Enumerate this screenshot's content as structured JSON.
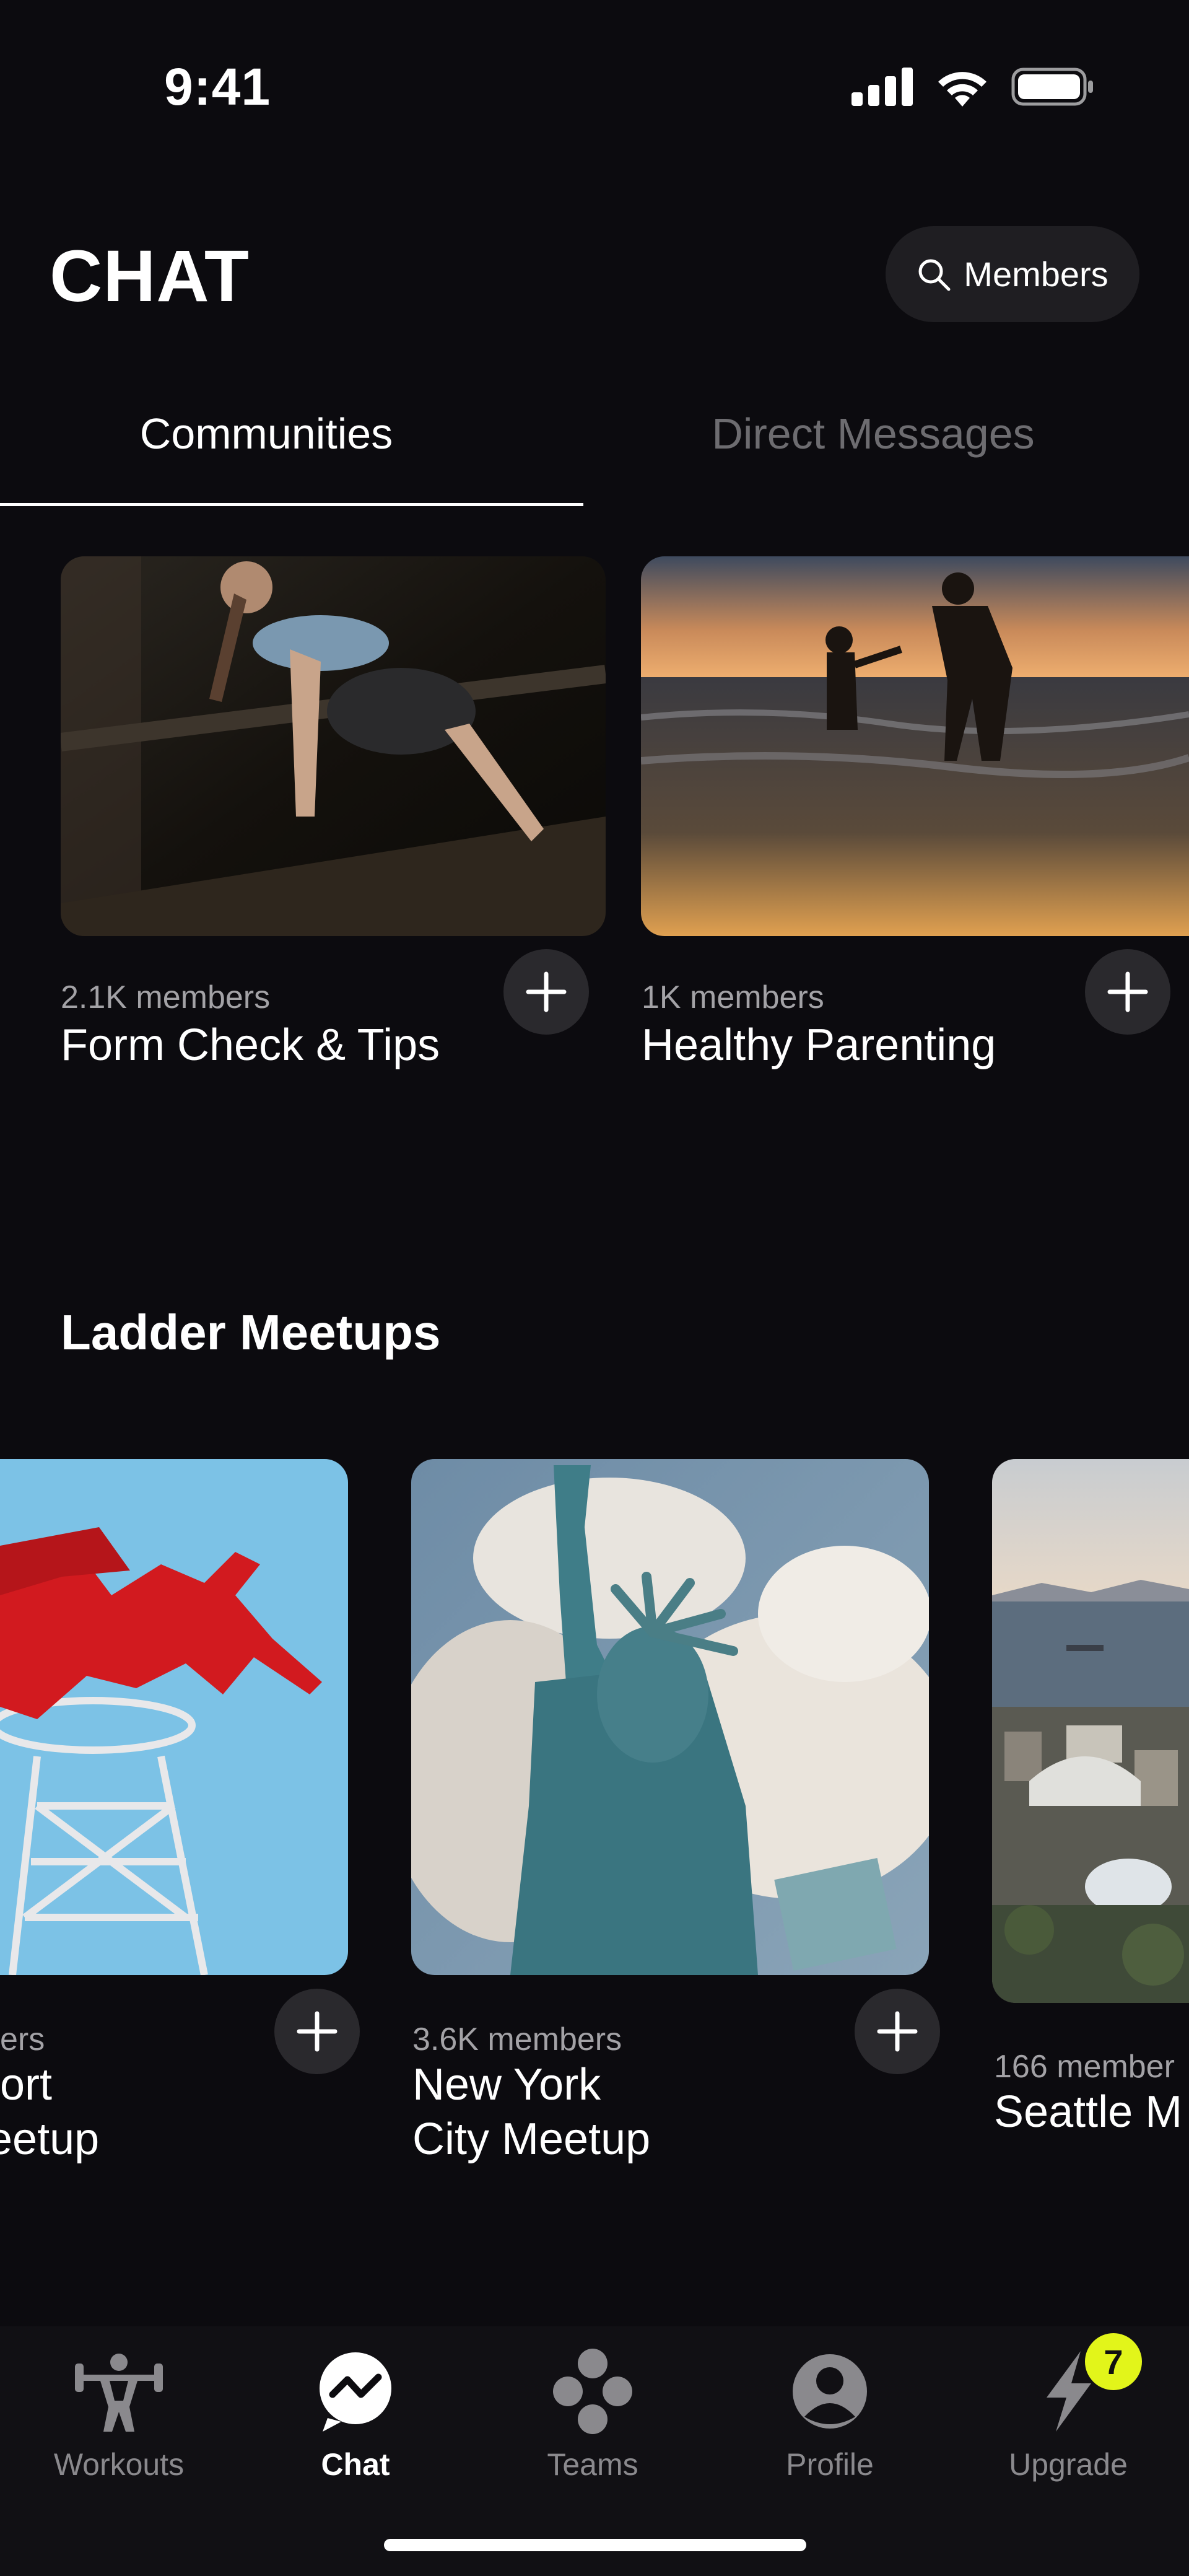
{
  "status_bar": {
    "time": "9:41",
    "icons": [
      "signal-icon",
      "wifi-icon",
      "battery-icon"
    ]
  },
  "header": {
    "title": "CHAT",
    "members_button": {
      "label": "Members",
      "icon": "search-icon"
    }
  },
  "tabs": [
    {
      "label": "Communities",
      "active": true
    },
    {
      "label": "Direct Messages",
      "active": false
    }
  ],
  "communities": [
    {
      "members": "2.1K members",
      "title": "Form Check & Tips",
      "image": "yoga-photo"
    },
    {
      "members": "1K members",
      "title": "Healthy Parenting",
      "image": "beach-sunset-photo"
    }
  ],
  "meetups": {
    "title": "Ladder Meetups",
    "items": [
      {
        "members": "ers",
        "title_line1": "ort",
        "title_line2": "eetup",
        "image": "pegasus-sign-photo"
      },
      {
        "members": "3.6K members",
        "title_line1": "New York",
        "title_line2": "City Meetup",
        "image": "statue-of-liberty-photo"
      },
      {
        "members": "166 member",
        "title_line1": "Seattle M",
        "title_line2": "",
        "image": "seattle-photo"
      }
    ]
  },
  "bottom_nav": {
    "items": [
      {
        "label": "Workouts",
        "icon": "weightlifter-icon",
        "active": false
      },
      {
        "label": "Chat",
        "icon": "chat-icon",
        "active": true
      },
      {
        "label": "Teams",
        "icon": "teams-icon",
        "active": false
      },
      {
        "label": "Profile",
        "icon": "profile-icon",
        "active": false
      },
      {
        "label": "Upgrade",
        "icon": "lightning-icon",
        "active": false
      }
    ],
    "upgrade_badge": "7"
  },
  "colors": {
    "background": "#0c0b0f",
    "badge": "#e2f51a",
    "inactive": "#8a898d"
  }
}
